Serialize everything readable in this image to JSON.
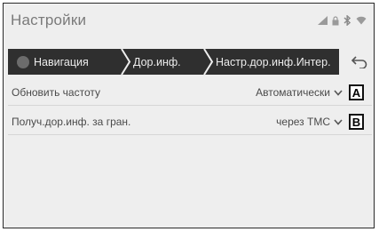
{
  "header": {
    "title": "Настройки"
  },
  "status_icons": [
    "signal-icon",
    "lock-icon",
    "bluetooth-icon",
    "wifi-icon"
  ],
  "breadcrumb": {
    "items": [
      {
        "label": "Навигация"
      },
      {
        "label": "Дор.инф."
      },
      {
        "label": "Настр.дор.инф.Интер."
      }
    ],
    "back_icon": "back-arrow-icon"
  },
  "settings": [
    {
      "label": "Обновить частоту",
      "value": "Автоматически",
      "marker": "A"
    },
    {
      "label": "Получ.дор.инф. за гран.",
      "value": "через TMC",
      "marker": "B"
    }
  ],
  "colors": {
    "crumb_bg": "#2f2f2f",
    "screen_bg": "#eeeeee",
    "text": "#4a4a4a"
  }
}
